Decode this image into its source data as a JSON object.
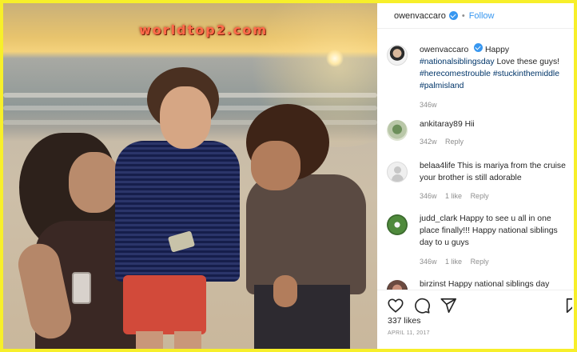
{
  "watermark": "worldtop2.com",
  "post": {
    "author": "owenvaccaro",
    "follow_label": "Follow",
    "separator": "•"
  },
  "comments": [
    {
      "user": "owenvaccaro",
      "verified": true,
      "text_plain": "Happy",
      "tags": [
        "#nationalsiblingsday",
        "Love these guys!",
        "#herecomestrouble",
        "#stuckinthemiddle",
        "#palmisland"
      ],
      "age": "346w"
    },
    {
      "user": "ankitaray89",
      "text": "Hii",
      "age": "342w",
      "reply": "Reply"
    },
    {
      "user": "belaa4life",
      "text": "This is mariya from the cruise your brother is still adorable",
      "age": "346w",
      "likes": "1 like",
      "reply": "Reply"
    },
    {
      "user": "judd_clark",
      "text": "Happy to see u all in one place finally!!! Happy national siblings day to u guys",
      "age": "346w",
      "likes": "1 like",
      "reply": "Reply"
    },
    {
      "user": "birzinst",
      "text": "Happy national siblings day"
    }
  ],
  "stats": {
    "likes": "337 likes",
    "date": "APRIL 11, 2017"
  },
  "icons": [
    "heart-icon",
    "comment-icon",
    "share-icon",
    "bookmark-icon",
    "verified-icon"
  ],
  "colors": {
    "frame": "#f7ef2a",
    "link": "#3897f0",
    "hashtag": "#003569",
    "muted": "#8e8e8e"
  }
}
